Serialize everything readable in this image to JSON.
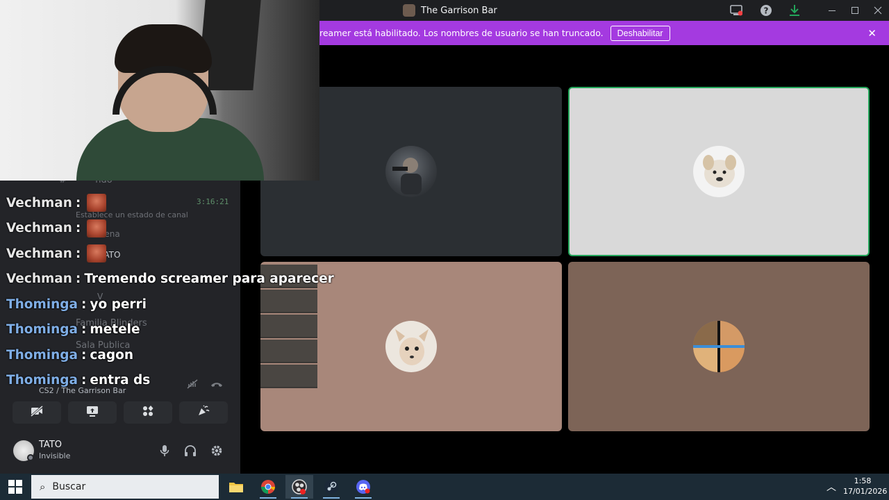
{
  "window": {
    "title": "The Garrison Bar",
    "icons": [
      "screen-share-icon",
      "help-icon",
      "download-icon"
    ],
    "controls": [
      "minimize",
      "maximize",
      "close"
    ]
  },
  "banner": {
    "text": "reamer está habilitado. Los nombres de usuario se han truncado.",
    "button_label": "Deshabilitar",
    "bg_color": "#a43ae0"
  },
  "voice_tiles": [
    {
      "name": "tile-1",
      "bg": "#2b2f33",
      "speaking": false
    },
    {
      "name": "tile-2",
      "bg": "#d9d9d9",
      "speaking": true
    },
    {
      "name": "tile-3",
      "bg": "#a8877a",
      "speaking": false
    },
    {
      "name": "tile-4",
      "bg": "#7d6457",
      "speaking": false
    }
  ],
  "sidebar_ghost": {
    "channel_partial": "ndo",
    "status_placeholder": "Establece un estado de canal",
    "member_1": "Mena",
    "member_2": "TATO",
    "member_3": "V",
    "channel_2": "Familia Blinders",
    "channel_3": "Sala Publica"
  },
  "chat": {
    "timestamp": "3:16:21",
    "messages": [
      {
        "user": "Vechman",
        "text": "",
        "emote": true
      },
      {
        "user": "Vechman",
        "text": "",
        "emote": true
      },
      {
        "user": "Vechman",
        "text": "",
        "emote": true
      },
      {
        "user": "Vechman",
        "text": "Tremendo screamer para aparecer",
        "emote": false
      },
      {
        "user": "Thominga",
        "text": "yo perri",
        "emote": false
      },
      {
        "user": "Thominga",
        "text": "metele",
        "emote": false
      },
      {
        "user": "Thominga",
        "text": "cagon",
        "emote": false
      },
      {
        "user": "Thominga",
        "text": "entra ds",
        "emote": false
      }
    ],
    "separator": ":"
  },
  "voice_status": {
    "location": "CS2 / The Garrison Bar"
  },
  "actions": [
    "camera-off-icon",
    "screen-share-icon",
    "activities-icon",
    "soundboard-icon"
  ],
  "user_panel": {
    "name": "TATO",
    "status": "Invisible"
  },
  "taskbar": {
    "search_placeholder": "Buscar",
    "time": "1:58",
    "date": "17/01/2026",
    "apps": [
      "file-explorer-icon",
      "chrome-icon",
      "obs-icon",
      "steam-icon",
      "discord-icon"
    ]
  }
}
